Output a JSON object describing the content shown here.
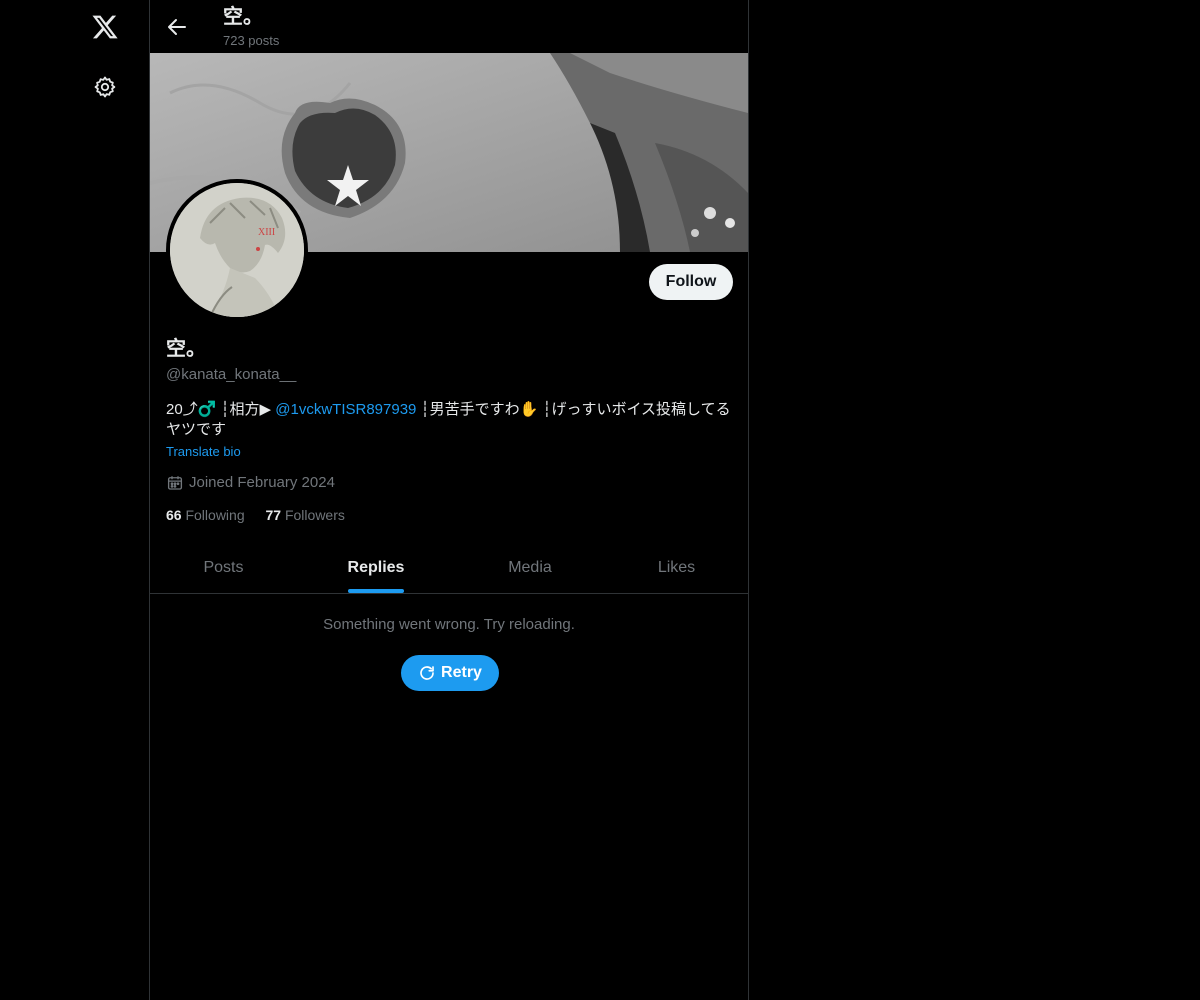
{
  "nav": {
    "logo": "x-logo",
    "settings_icon": "gear-icon"
  },
  "header": {
    "back_icon": "arrow-left-icon",
    "name": "空。",
    "post_count": "723 posts"
  },
  "profile": {
    "display_name": "空。",
    "handle": "@kanata_konata__",
    "follow_label": "Follow",
    "bio_before": "20⤴︎♂️ ┆相方▶ ",
    "bio_mention": "@1vckwTISR897939",
    "bio_after": " ┆男苦手ですわ✋ ┆げっすいボイス投稿してるヤツです",
    "translate_label": "Translate bio",
    "joined": "Joined February 2024",
    "following_count": "66",
    "following_label": "Following",
    "followers_count": "77",
    "followers_label": "Followers"
  },
  "tabs": [
    {
      "label": "Posts",
      "active": false
    },
    {
      "label": "Replies",
      "active": true
    },
    {
      "label": "Media",
      "active": false
    },
    {
      "label": "Likes",
      "active": false
    }
  ],
  "error": {
    "message": "Something went wrong. Try reloading.",
    "retry_label": "Retry"
  },
  "colors": {
    "background": "#000000",
    "accent": "#1d9bf0",
    "muted": "#71767b",
    "text": "#e7e9ea",
    "border": "#2f3336"
  }
}
